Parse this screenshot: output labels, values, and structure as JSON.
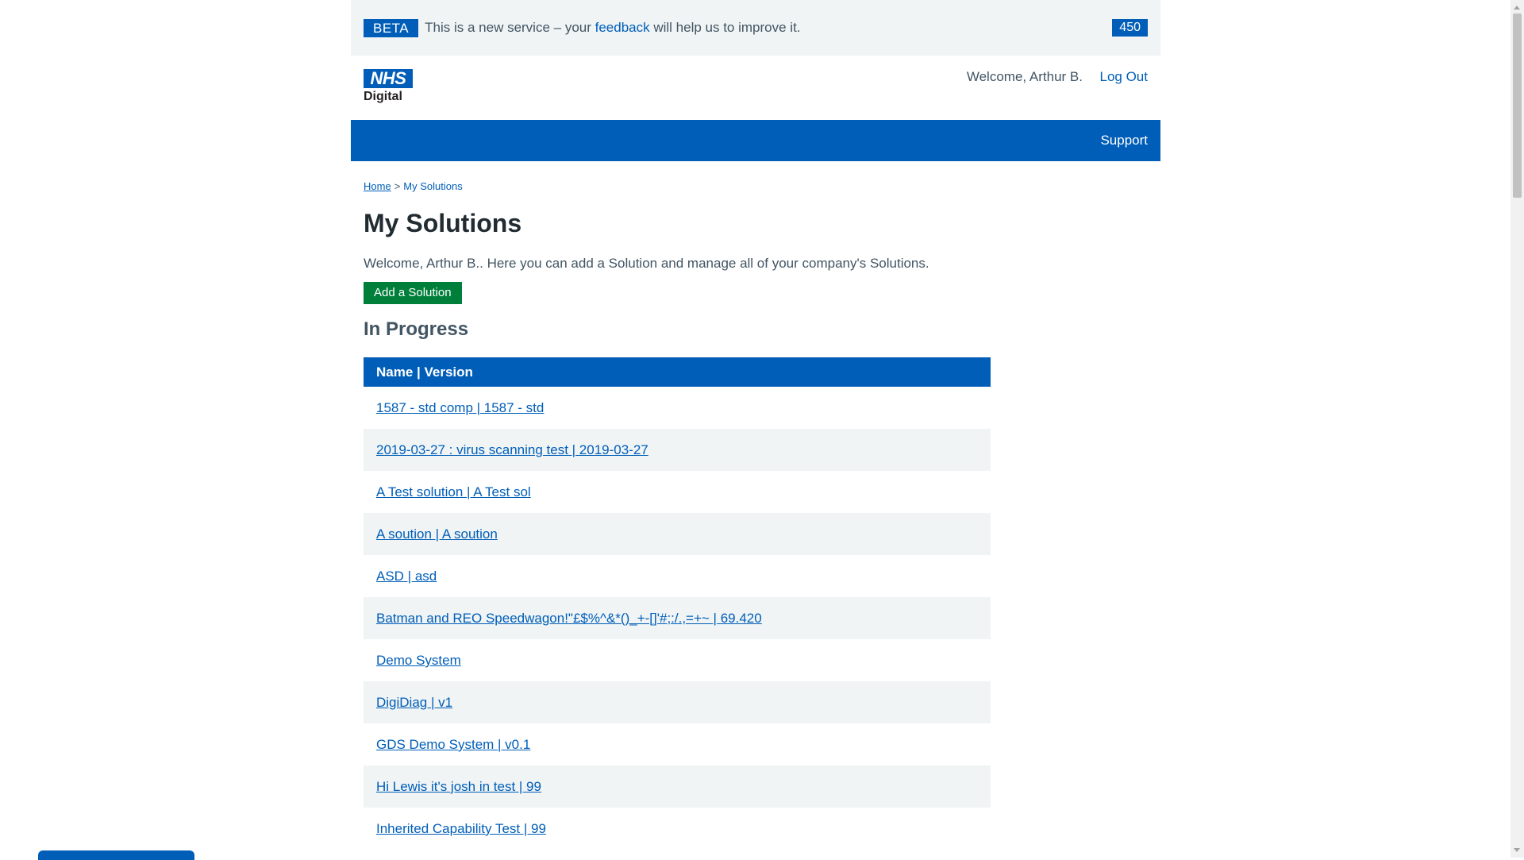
{
  "banner": {
    "tag": "BETA",
    "text_before": "This is a new service – your ",
    "link": "feedback",
    "text_after": " will help us to improve it.",
    "count": "450"
  },
  "header": {
    "logo_nhs": "NHS",
    "logo_sub": "Digital",
    "welcome": "Welcome, Arthur B.",
    "logout": "Log Out"
  },
  "nav": {
    "support": "Support"
  },
  "breadcrumb": {
    "home": "Home",
    "separator": ">",
    "current": "My Solutions"
  },
  "main": {
    "title": "My Solutions",
    "intro": "Welcome, Arthur B.. Here you can add a Solution and manage all of your company's Solutions.",
    "add_button": "Add a Solution",
    "section_title": "In Progress",
    "table_header": "Name | Version",
    "rows": [
      "1587 - std comp | 1587 - std",
      "2019-03-27 : virus scanning test | 2019-03-27",
      "A Test solution | A Test sol",
      "A soution | A soution",
      "ASD | asd",
      "Batman and REO Speedwagon!\"£$%^&*()_+-[]'#;:/.,=+~ | 69.420",
      "Demo System",
      "DigiDiag | v1",
      "GDS Demo System | v0.1",
      "Hi Lewis it's josh in test | 99",
      "Inherited Capability Test | 99"
    ]
  },
  "colors": {
    "brand_blue": "#005eb8",
    "green": "#007f3b",
    "grey_bg": "#f0f4f5"
  }
}
